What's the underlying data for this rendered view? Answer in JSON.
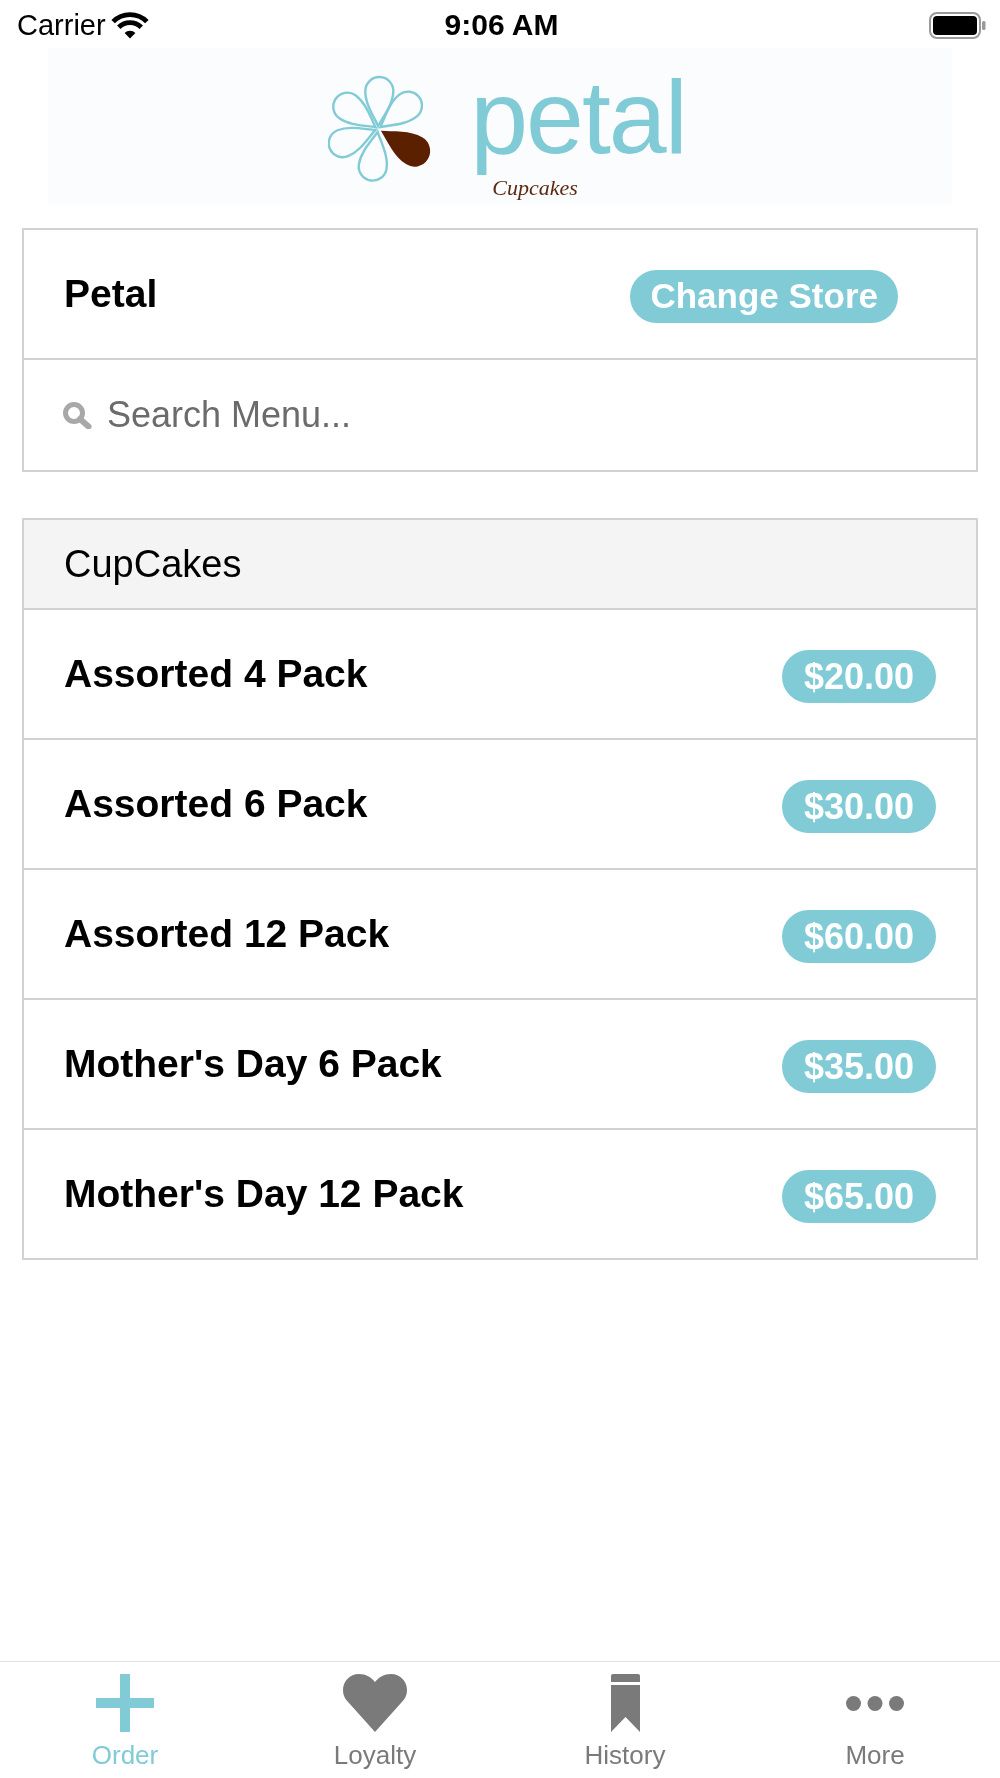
{
  "status_bar": {
    "carrier": "Carrier",
    "time": "9:06 AM"
  },
  "logo": {
    "wordmark": "petal",
    "tagline": "Cupcakes"
  },
  "store": {
    "name": "Petal",
    "button": "Change Store"
  },
  "search": {
    "placeholder": "Search Menu..."
  },
  "menu": {
    "category": "CupCakes",
    "items": [
      {
        "name": "Assorted 4 Pack",
        "price": "$20.00"
      },
      {
        "name": "Assorted 6 Pack",
        "price": "$30.00"
      },
      {
        "name": "Assorted 12 Pack",
        "price": "$60.00"
      },
      {
        "name": "Mother's Day 6 Pack",
        "price": "$35.00"
      },
      {
        "name": "Mother's Day 12 Pack",
        "price": "$65.00"
      }
    ]
  },
  "tabs": [
    {
      "label": "Order",
      "selected": true
    },
    {
      "label": "Loyalty",
      "selected": false
    },
    {
      "label": "History",
      "selected": false
    },
    {
      "label": "More",
      "selected": false
    }
  ]
}
